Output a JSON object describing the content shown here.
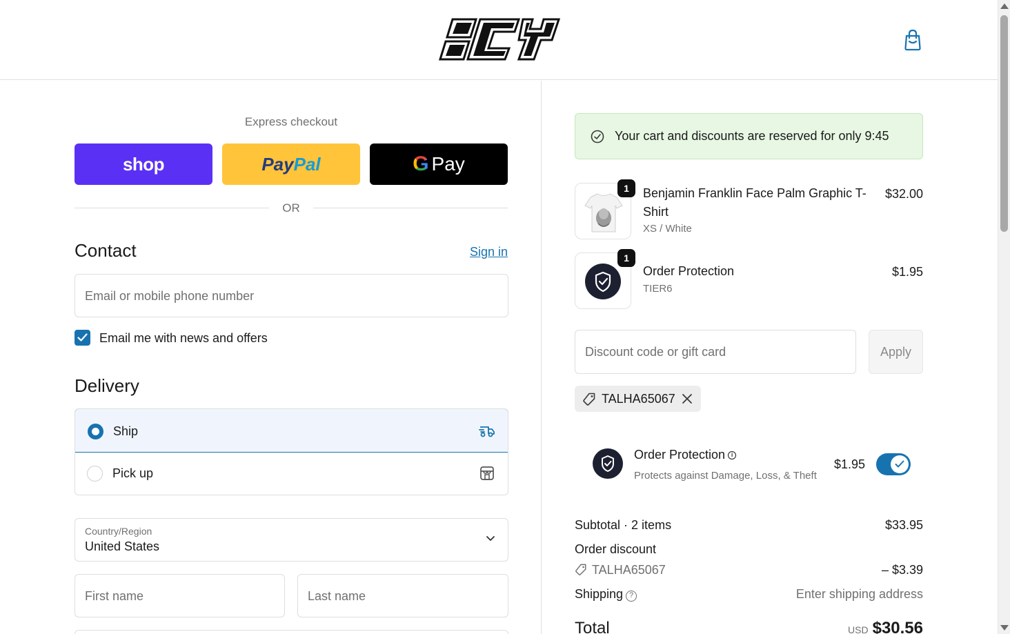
{
  "header": {
    "logo_text": "ICY",
    "cart_icon": "bag-icon"
  },
  "express": {
    "title": "Express checkout",
    "shop_label": "shop",
    "paypal_label_1": "Pay",
    "paypal_label_2": "Pal",
    "gpay_g": "G",
    "gpay_label": "Pay",
    "or_text": "OR"
  },
  "contact": {
    "title": "Contact",
    "sign_in": "Sign in",
    "email_placeholder": "Email or mobile phone number",
    "newsletter_label": "Email me with news and offers",
    "newsletter_checked": true
  },
  "delivery": {
    "title": "Delivery",
    "options": [
      {
        "label": "Ship",
        "selected": true,
        "icon": "truck-icon"
      },
      {
        "label": "Pick up",
        "selected": false,
        "icon": "store-icon"
      }
    ],
    "country_label": "Country/Region",
    "country_value": "United States",
    "first_name_placeholder": "First name",
    "last_name_placeholder": "Last name"
  },
  "summary": {
    "reservation_text": "Your cart and discounts are reserved for only 9:45",
    "items": [
      {
        "title_line1": "Benjamin Franklin Face Palm Graphic T-",
        "title_line2": "Shirt",
        "variant": "XS / White",
        "price": "$32.00",
        "qty": "1"
      },
      {
        "title_line1": "Order Protection",
        "title_line2": "",
        "variant": "TIER6",
        "price": "$1.95",
        "qty": "1"
      }
    ],
    "discount_placeholder": "Discount code or gift card",
    "apply_label": "Apply",
    "applied_code": "TALHA65067",
    "order_protection": {
      "title": "Order Protection",
      "info_glyph": "i",
      "description": "Protects against Damage, Loss, & Theft",
      "price": "$1.95",
      "enabled": true
    },
    "subtotal_label": "Subtotal · 2 items",
    "subtotal_value": "$33.95",
    "order_discount_label": "Order discount",
    "discount_code": "TALHA65067",
    "discount_value": "– $3.39",
    "shipping_label": "Shipping",
    "shipping_help": "?",
    "shipping_value": "Enter shipping address",
    "total_label": "Total",
    "currency": "USD",
    "total_value": "$30.56"
  },
  "colors": {
    "accent": "#1773b0",
    "shop": "#5a31f4",
    "paypal": "#ffc439",
    "banner_bg": "#e7f7e3"
  }
}
